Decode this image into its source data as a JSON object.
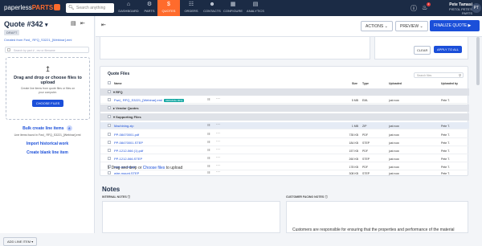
{
  "topbar": {
    "logo_text": "paperless",
    "logo_brand": "PARTS",
    "search_placeholder": "Search anything",
    "nav": [
      {
        "label": "DASHBOARD",
        "icon": "home-icon"
      },
      {
        "label": "PARTS",
        "icon": "parts-icon"
      },
      {
        "label": "QUOTES",
        "icon": "dollar-icon"
      },
      {
        "label": "ORDERS",
        "icon": "orders-icon"
      },
      {
        "label": "CONTACTS",
        "icon": "contacts-icon"
      },
      {
        "label": "CONFIGURE",
        "icon": "configure-icon"
      },
      {
        "label": "ANALYTICS",
        "icon": "analytics-icon"
      }
    ],
    "notif_count": "2",
    "user_name": "Pete Tamasi",
    "user_company": "PISTOL PETE'S PARTS",
    "avatar_initials": "PT"
  },
  "sidebar": {
    "quote_title": "Quote #342",
    "status": "DRAFT",
    "created_from": "Created from Fwd_ RFQ_S3221_[Webinar].eml",
    "search_placeholder": "Search by part # , rev or filename",
    "drop_title": "Drag and drop or choose files to upload",
    "drop_sub1": "Create line items from quote files or files on",
    "drop_sub2": "your computer.",
    "choose_files": "CHOOSE FILES",
    "bulk_create": "Bulk create line items",
    "bulk_badge": "8",
    "line_items_found": "Line items found in Fwd_ RFQ_S3221_[Webinar].eml",
    "import_history": "Import historical work",
    "create_blank": "Create blank line item",
    "add_line_item": "ADD LINE ITEM"
  },
  "header": {
    "actions_label": "ACTIONS",
    "preview_label": "PREVIEW",
    "finalize_label": "FINALIZE QUOTE"
  },
  "filters": {
    "clear_label": "CLEAR",
    "apply_label": "APPLY TO ALL"
  },
  "quote_files": {
    "title": "Quote Files",
    "search_placeholder": "Search files",
    "columns": {
      "name": "Name",
      "size": "Size",
      "type": "Type",
      "uploaded": "Uploaded",
      "uploaded_by": "Uploaded by"
    },
    "groups": {
      "rfq": "RFQ",
      "vendor": "Vendor Quotes",
      "supporting": "Supporting Files"
    },
    "rfq_file": {
      "name": "Fwd_ RFQ_S3221_[Webinar].eml",
      "badge": "ORIGINAL RFQ",
      "size": "5 MB",
      "type": "EML",
      "uploaded": "just now",
      "by": "Pete T."
    },
    "supporting_files": [
      {
        "name": "Machining.zip",
        "size": "1 MB",
        "type": "ZIP",
        "uploaded": "just now",
        "by": "Pete T."
      },
      {
        "name": "PP-08470001.pdf",
        "size": "735 KB",
        "type": "PDF",
        "uploaded": "just now",
        "by": "Pete T."
      },
      {
        "name": "PP-08470001.STEP",
        "size": "184 KB",
        "type": "STEP",
        "uploaded": "just now",
        "by": "Pete T."
      },
      {
        "name": "PP-1212-066 (1).pdf",
        "size": "157 KB",
        "type": "PDF",
        "uploaded": "just now",
        "by": "Pete T."
      },
      {
        "name": "PP-1212-066.STEP",
        "size": "260 KB",
        "type": "STEP",
        "uploaded": "just now",
        "by": "Pete T."
      },
      {
        "name": "wire-mount.pdf",
        "size": "178 KB",
        "type": "PDF",
        "uploaded": "just now",
        "by": "Pete T."
      },
      {
        "name": "wire-mount.STEP",
        "size": "308 KB",
        "type": "STEP",
        "uploaded": "just now",
        "by": "Pete T."
      }
    ],
    "drop_text": "Drag and drop or",
    "drop_link": "Choose files",
    "drop_tail": "to upload"
  },
  "notes": {
    "title": "Notes",
    "internal_label": "INTERNAL NOTES",
    "customer_label": "CUSTOMER FACING NOTES",
    "customer_text": "Customers are responsible for ensuring that the properties and performance of the material"
  },
  "colors": {
    "navy": "#1b2b45",
    "accent": "#ff6b2c",
    "primary": "#1b4fd9",
    "badge": "#12a7a2"
  }
}
